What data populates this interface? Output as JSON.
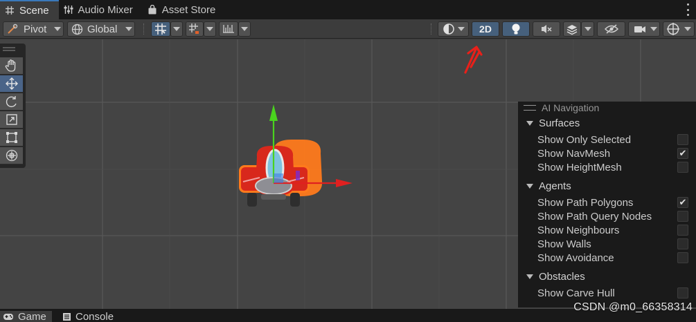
{
  "top_tabs": [
    {
      "label": "Scene",
      "icon": "scene-grid-icon",
      "active": true
    },
    {
      "label": "Audio Mixer",
      "icon": "mixer-sliders-icon"
    },
    {
      "label": "Asset Store",
      "icon": "shopping-bag-icon"
    }
  ],
  "toolbar": {
    "pivot_label": "Pivot",
    "global_label": "Global",
    "mode_2d_label": "2D",
    "icons": [
      "grid-snap-icon",
      "increment-snap-icon",
      "ruler-icon",
      "shading-mode-icon",
      "lighting-icon",
      "audio-mute-icon",
      "effects-icon",
      "visibility-icon",
      "camera-icon",
      "gizmos-icon"
    ]
  },
  "tools": [
    "hand-tool-icon",
    "move-tool-icon",
    "rotate-tool-icon",
    "scale-tool-icon",
    "rect-tool-icon",
    "transform-tool-icon"
  ],
  "ai_navigation": {
    "title": "AI Navigation",
    "sections": [
      {
        "label": "Surfaces",
        "items": [
          {
            "label": "Show Only Selected",
            "checked": false
          },
          {
            "label": "Show NavMesh",
            "checked": true
          },
          {
            "label": "Show HeightMesh",
            "checked": false
          }
        ]
      },
      {
        "label": "Agents",
        "items": [
          {
            "label": "Show Path Polygons",
            "checked": true
          },
          {
            "label": "Show Path Query Nodes",
            "checked": false
          },
          {
            "label": "Show Neighbours",
            "checked": false
          },
          {
            "label": "Show Walls",
            "checked": false
          },
          {
            "label": "Show Avoidance",
            "checked": false
          }
        ]
      },
      {
        "label": "Obstacles",
        "items": [
          {
            "label": "Show Carve Hull",
            "checked": false
          }
        ]
      }
    ]
  },
  "bottom_tabs": [
    {
      "label": "Game",
      "icon": "gamepad-icon",
      "active": true
    },
    {
      "label": "Console",
      "icon": "console-icon"
    }
  ],
  "watermark": "CSDN @m0_66358314",
  "colors": {
    "accent": "#3a79bb",
    "active_blue": "#46607c",
    "x_axis": "#e02020",
    "y_axis": "#4ad31e",
    "annotation": "#e8201a"
  }
}
